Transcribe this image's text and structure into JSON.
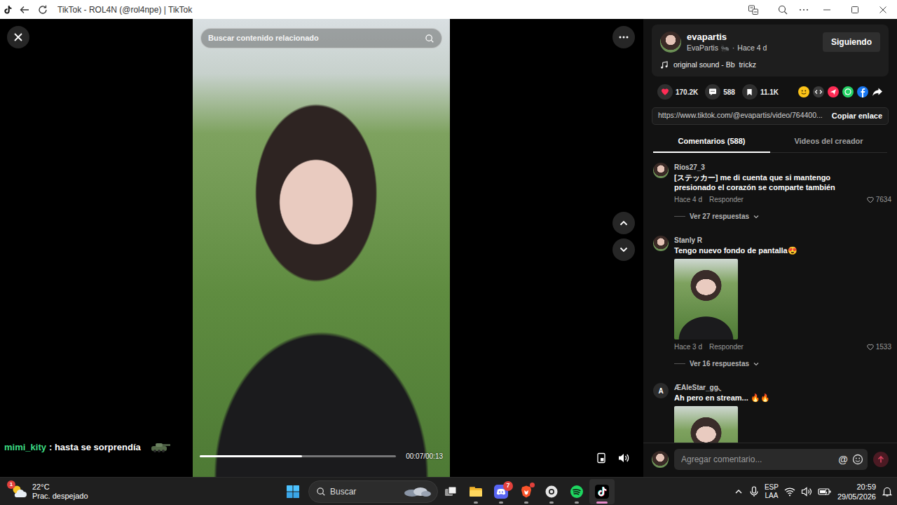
{
  "window": {
    "title": "TikTok - ROL4N (@rol4npe) | TikTok"
  },
  "player": {
    "search_placeholder": "Buscar contenido relacionado",
    "time": "00:07/00:13",
    "level": 0.52,
    "muted": false
  },
  "overlay_chat": {
    "user": "mimi_kity",
    "message": ": hasta se sorprendía"
  },
  "creator": {
    "handle": "evapartis",
    "name": "EvaPartis 🐜",
    "separator": "·",
    "age": "Hace 4 d",
    "follow_label": "Siguiendo",
    "sound": "original sound - Bb  trickz"
  },
  "stats": [
    {
      "kind": "like",
      "label": "170.2K",
      "active": true
    },
    {
      "kind": "comment",
      "label": "588",
      "active": false
    },
    {
      "kind": "save",
      "label": "11.1K",
      "active": false
    }
  ],
  "share_targets": [
    {
      "kind": "friends",
      "color": "#fcc419"
    },
    {
      "kind": "embed",
      "color": "#3a3a3a"
    },
    {
      "kind": "send",
      "color": "#fe2c55"
    },
    {
      "kind": "whatsapp",
      "color": "#25d366"
    },
    {
      "kind": "facebook",
      "color": "#1877f2"
    },
    {
      "kind": "forward",
      "color": "#ffffff"
    }
  ],
  "link": {
    "url": "https://www.tiktok.com/@evapartis/video/764400...",
    "copy_label": "Copiar enlace"
  },
  "tabs": [
    {
      "label": "Comentarios (588)",
      "selected": true
    },
    {
      "label": "Videos del creador",
      "selected": false
    }
  ],
  "comments": [
    {
      "user": "Rios27_3",
      "text": "[ステッカー] me di cuenta que si mantengo presionado el corazón se comparte también",
      "has_image": false,
      "age": "Hace 4 d",
      "reply_label": "Responder",
      "likes": "7634",
      "liked": false,
      "replies": "Ver 27 respuestas"
    },
    {
      "user": "Stanly R",
      "text": "Tengo nuevo fondo de pantalla😍",
      "has_image": true,
      "age": "Hace 3 d",
      "reply_label": "Responder",
      "likes": "1533",
      "liked": false,
      "replies": "Ver 16 respuestas"
    },
    {
      "user": "ÆAleStar_gg◟",
      "avatar_letter": "A",
      "text": "Ah pero en stream... 🔥🔥",
      "has_image": true
    }
  ],
  "comment_box": {
    "placeholder": "Agregar comentario...",
    "mention": "@"
  },
  "taskbar": {
    "weather": {
      "temp": "22°C",
      "desc": "Prac. despejado",
      "badge": "1"
    },
    "search": "Buscar",
    "apps": [
      {
        "kind": "taskview",
        "running": false,
        "active": false,
        "alert": false
      },
      {
        "kind": "explorer",
        "running": true,
        "active": false,
        "alert": false
      },
      {
        "kind": "discord",
        "running": true,
        "active": false,
        "alert": false,
        "badge": "7"
      },
      {
        "kind": "brave",
        "running": true,
        "active": false,
        "alert": true
      },
      {
        "kind": "app",
        "running": true,
        "active": false,
        "alert": false
      },
      {
        "kind": "spotify",
        "running": true,
        "active": false,
        "alert": false
      },
      {
        "kind": "tiktok",
        "running": true,
        "active": true,
        "alert": false
      }
    ],
    "lang": "ESP",
    "layout": "LAA",
    "time": "20:59",
    "date": "29/05/2026"
  }
}
